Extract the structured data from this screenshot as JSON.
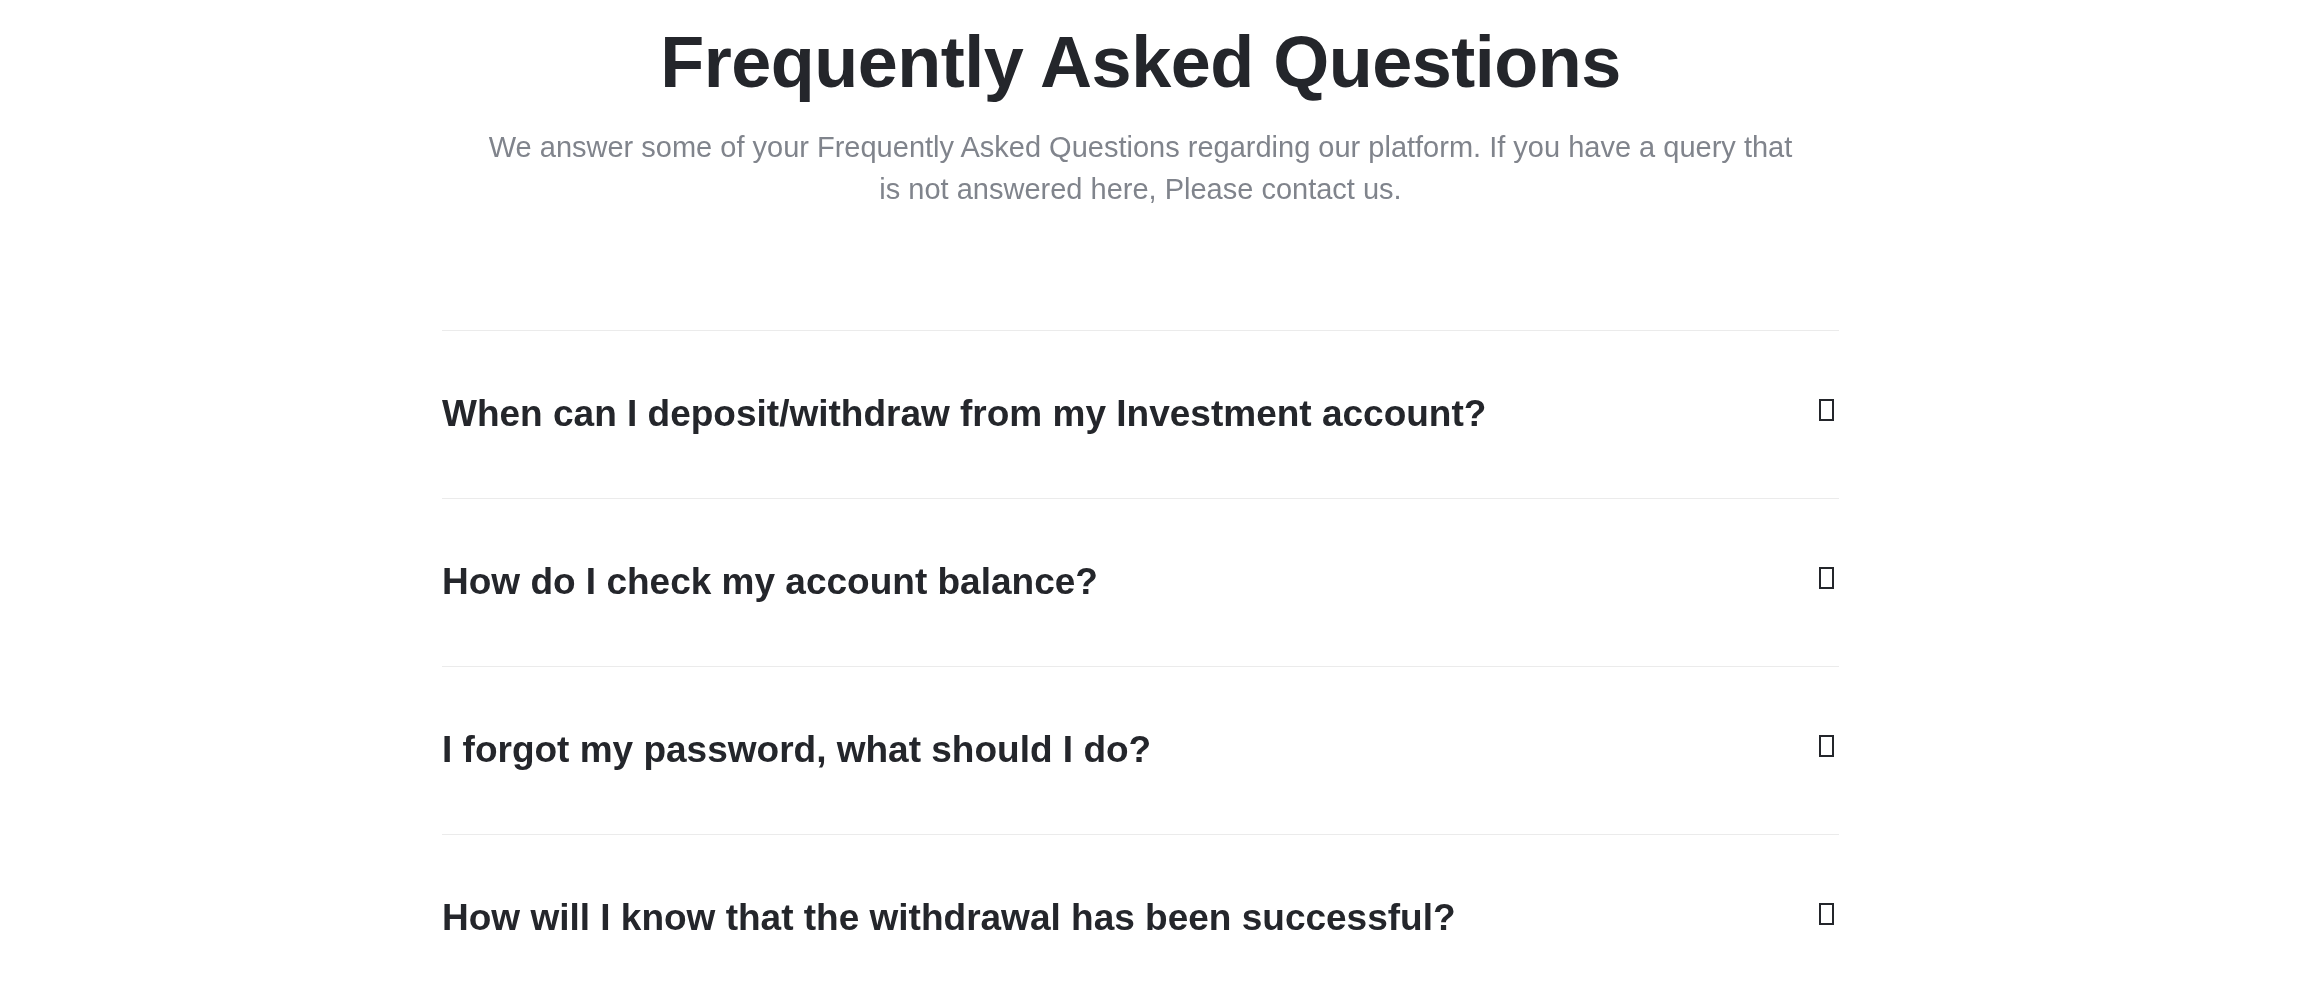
{
  "heading": {
    "title": "Frequently Asked Questions",
    "subtitle": "We answer some of your Frequently Asked Questions regarding our platform. If you have a query that is not answered here, Please contact us."
  },
  "faqs": [
    {
      "question": "When can I deposit/withdraw from my Investment account?"
    },
    {
      "question": "How do I check my account balance?"
    },
    {
      "question": "I forgot my password, what should I do?"
    },
    {
      "question": "How will I know that the withdrawal has been successful?"
    }
  ]
}
